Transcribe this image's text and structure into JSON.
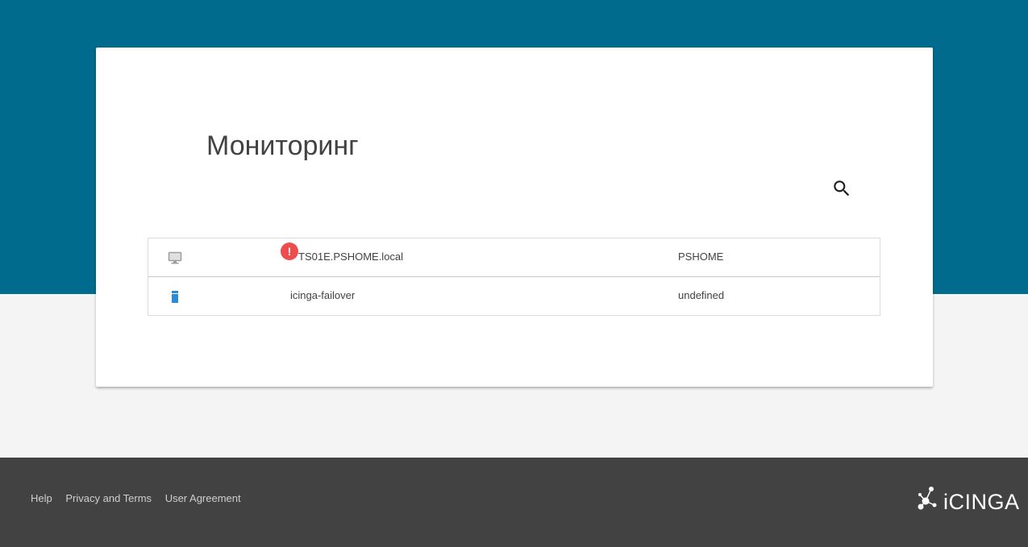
{
  "page": {
    "title": "Мониторинг"
  },
  "search": {
    "icon": "search-icon"
  },
  "hosts": [
    {
      "name": "TS01E.PSHOME.local",
      "domain": "PSHOME",
      "icon": "monitor-icon",
      "status_badge": "!",
      "status_color": "#ef4d4d"
    },
    {
      "name": "icinga-failover",
      "domain": "undefined",
      "icon": "server-icon"
    }
  ],
  "footer": {
    "links": [
      "Help",
      "Privacy and Terms",
      "User Agreement"
    ],
    "logo_text": "iCINGA"
  },
  "colors": {
    "header_bg": "#006b8d",
    "page_bg": "#f4f4f4",
    "footer_bg": "#424242",
    "server_icon": "#2c8ad6",
    "error_badge": "#ef4d4d"
  }
}
